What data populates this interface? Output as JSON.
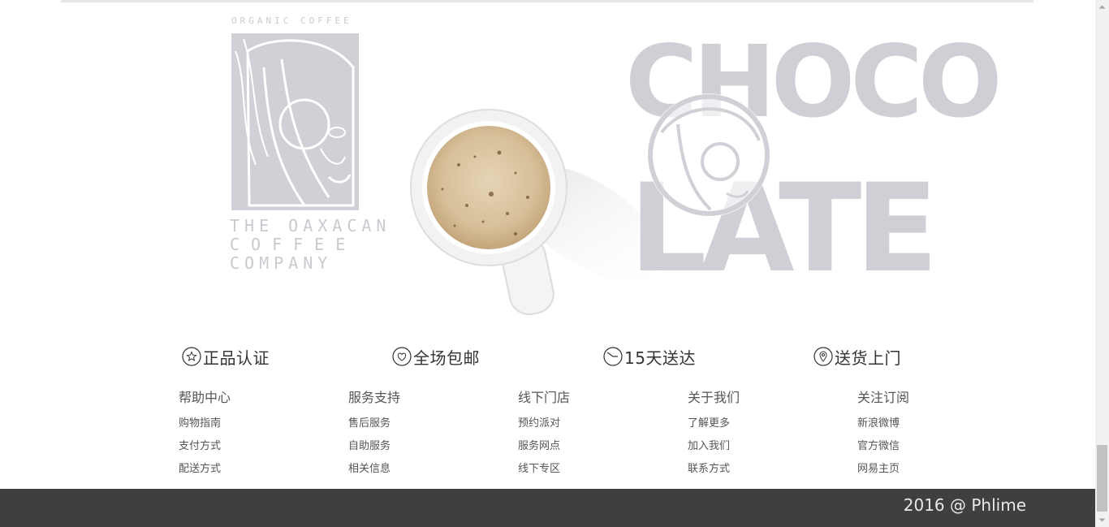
{
  "hero": {
    "logo_top_text": "ORGANIC COFFEE",
    "logo_bottom_lines": [
      "THE OAXACAN",
      "COFFEE",
      "COMPANY"
    ],
    "choco_lines": [
      "CHOCO",
      "LATE"
    ]
  },
  "features": [
    {
      "icon": "star-circle-icon",
      "label": "正品认证"
    },
    {
      "icon": "heart-circle-icon",
      "label": "全场包邮"
    },
    {
      "icon": "clock-circle-icon",
      "label": "15天送达"
    },
    {
      "icon": "location-pin-icon",
      "label": "送货上门"
    }
  ],
  "footer_columns": [
    {
      "title": "帮助中心",
      "links": [
        "购物指南",
        "支付方式",
        "配送方式"
      ]
    },
    {
      "title": "服务支持",
      "links": [
        "售后服务",
        "自助服务",
        "相关信息"
      ]
    },
    {
      "title": "线下门店",
      "links": [
        "预约派对",
        "服务网点",
        "线下专区"
      ]
    },
    {
      "title": "关于我们",
      "links": [
        "了解更多",
        "加入我们",
        "联系方式"
      ]
    },
    {
      "title": "关注订阅",
      "links": [
        "新浪微博",
        "官方微信",
        "网易主页"
      ]
    }
  ],
  "copyright": "2016 @ Phlime",
  "colors": {
    "footer_bg": "#3f3f3f",
    "logo_gray": "#c9cbd0",
    "coffee": "#d9c3a0"
  }
}
